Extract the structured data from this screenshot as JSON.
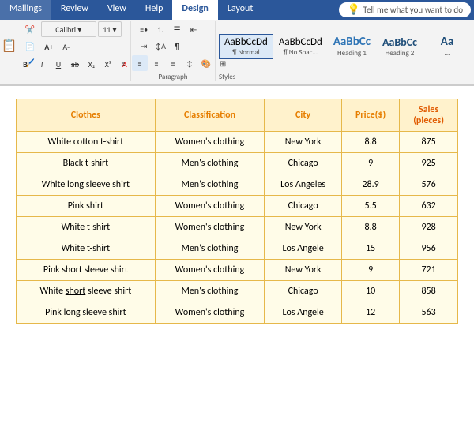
{
  "tabs": [
    {
      "label": "Mailings",
      "active": false
    },
    {
      "label": "Review",
      "active": false
    },
    {
      "label": "View",
      "active": false
    },
    {
      "label": "Help",
      "active": false
    },
    {
      "label": "Design",
      "active": true
    },
    {
      "label": "Layout",
      "active": false
    }
  ],
  "tell_me": "Tell me what you want to do",
  "styles": [
    {
      "label": "¶ Normal",
      "preview": "AaBbCcDd",
      "key": "normal",
      "active": true
    },
    {
      "label": "¶ No Spac...",
      "preview": "AaBbCcDd",
      "key": "nospace",
      "active": false
    },
    {
      "label": "Heading 1",
      "preview": "AaBbCc",
      "key": "h1",
      "active": false
    },
    {
      "label": "Heading 2",
      "preview": "AaBbCc",
      "key": "h2",
      "active": false
    }
  ],
  "paragraph_label": "Paragraph",
  "styles_label": "Styles",
  "table": {
    "headers": [
      "Clothes",
      "Classification",
      "City",
      "Price($)",
      "Sales\n(pieces)"
    ],
    "rows": [
      [
        "White cotton t-shirt",
        "Women's clothing",
        "New York",
        "8.8",
        "875"
      ],
      [
        "Black t-shirt",
        "Men's clothing",
        "Chicago",
        "9",
        "925"
      ],
      [
        "White long sleeve shirt",
        "Men's clothing",
        "Los Angeles",
        "28.9",
        "576"
      ],
      [
        "Pink shirt",
        "Women's clothing",
        "Chicago",
        "5.5",
        "632"
      ],
      [
        "White t-shirt",
        "Women's clothing",
        "New York",
        "8.8",
        "928"
      ],
      [
        "White t-shirt",
        "Men's clothing",
        "Los Angele",
        "15",
        "956"
      ],
      [
        "Pink short sleeve shirt",
        "Women's clothing",
        "New York",
        "9",
        "721"
      ],
      [
        "White short sleeve shirt",
        "Men's clothing",
        "Chicago",
        "10",
        "858"
      ],
      [
        "Pink long sleeve shirt",
        "Women's clothing",
        "Los Angele",
        "12",
        "563"
      ]
    ],
    "underline_row": 7,
    "underline_word": "short"
  }
}
